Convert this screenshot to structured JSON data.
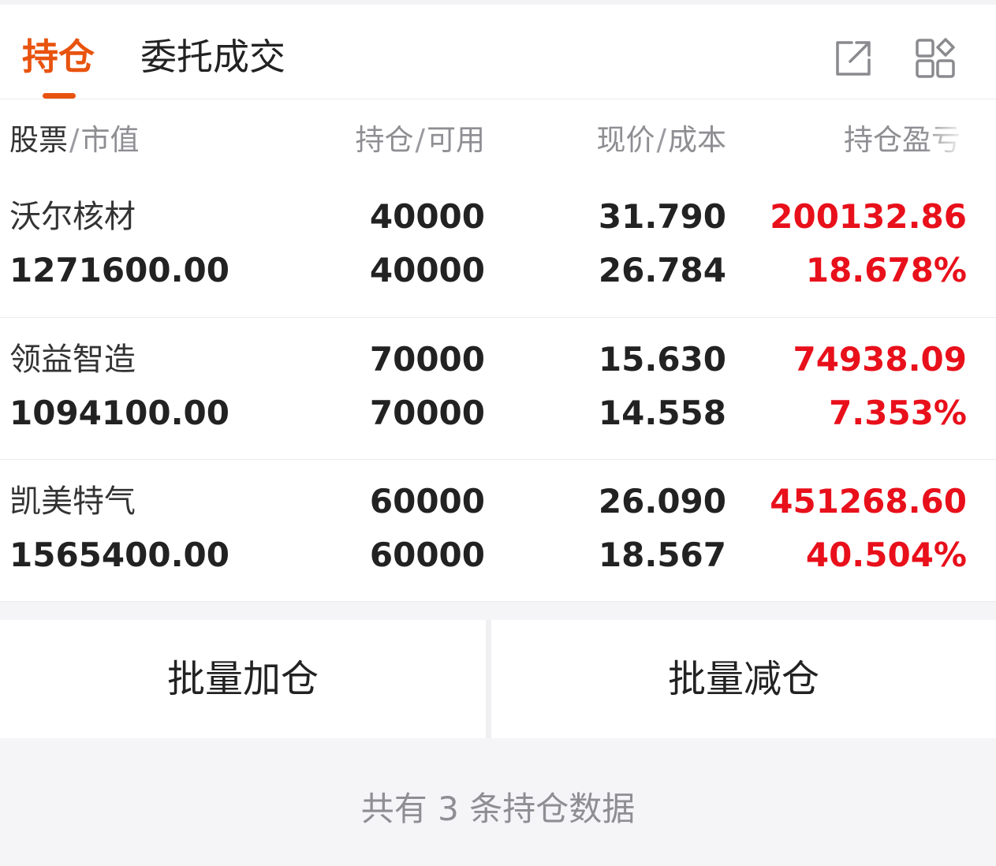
{
  "tabs": [
    {
      "label": "持仓",
      "active": true
    },
    {
      "label": "委托成交",
      "active": false
    }
  ],
  "icons": {
    "share": "share-external-icon",
    "layout": "grid-layout-icon"
  },
  "colors": {
    "accent": "#e8530e",
    "profit": "#e8101b"
  },
  "columns": {
    "stock": "股票",
    "market_value": "市值",
    "holding": "持仓",
    "available": "可用",
    "price": "现价",
    "cost": "成本",
    "pnl": "持仓盈亏",
    "separator": "/"
  },
  "positions": [
    {
      "name": "沃尔核材",
      "market_value": "1271600.00",
      "holding": "40000",
      "available": "40000",
      "price": "31.790",
      "cost": "26.784",
      "pnl": "200132.86",
      "pnl_pct": "18.678%"
    },
    {
      "name": "领益智造",
      "market_value": "1094100.00",
      "holding": "70000",
      "available": "70000",
      "price": "15.630",
      "cost": "14.558",
      "pnl": "74938.09",
      "pnl_pct": "7.353%"
    },
    {
      "name": "凯美特气",
      "market_value": "1565400.00",
      "holding": "60000",
      "available": "60000",
      "price": "26.090",
      "cost": "18.567",
      "pnl": "451268.60",
      "pnl_pct": "40.504%"
    }
  ],
  "actions": {
    "batch_add": "批量加仓",
    "batch_reduce": "批量减仓"
  },
  "footer": {
    "summary": "共有 3 条持仓数据"
  }
}
